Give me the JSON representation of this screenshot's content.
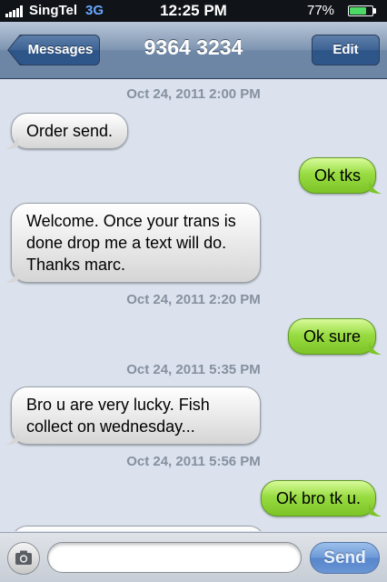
{
  "status_bar": {
    "carrier": "SingTel",
    "network": "3G",
    "time": "12:25 PM",
    "battery_percent": "77%",
    "battery_level": 0.77
  },
  "nav": {
    "back_label": "Messages",
    "title": "9364 3234",
    "edit_label": "Edit"
  },
  "messages": [
    {
      "type": "timestamp",
      "text": "Oct 24, 2011 2:00 PM"
    },
    {
      "type": "incoming",
      "text": "Order send."
    },
    {
      "type": "outgoing",
      "text": "Ok tks"
    },
    {
      "type": "incoming",
      "text": "Welcome. Once your trans is done drop me a text will do. Thanks marc."
    },
    {
      "type": "timestamp",
      "text": "Oct 24, 2011 2:20 PM"
    },
    {
      "type": "outgoing",
      "text": "Ok sure"
    },
    {
      "type": "timestamp",
      "text": "Oct 24, 2011 5:35 PM"
    },
    {
      "type": "incoming",
      "text": "Bro u are very lucky. Fish collect on wednesday..."
    },
    {
      "type": "timestamp",
      "text": "Oct 24, 2011 5:56 PM"
    },
    {
      "type": "outgoing",
      "text": "Ok bro tk u."
    }
  ],
  "input_bar": {
    "text_value": "",
    "placeholder": "",
    "send_label": "Send",
    "camera_icon": "camera-icon"
  },
  "colors": {
    "incoming_bubble": "#e6e6e6",
    "outgoing_bubble": "#98dc42",
    "conversation_bg": "#dbe2ed",
    "nav_bar": "#6e87a6"
  }
}
